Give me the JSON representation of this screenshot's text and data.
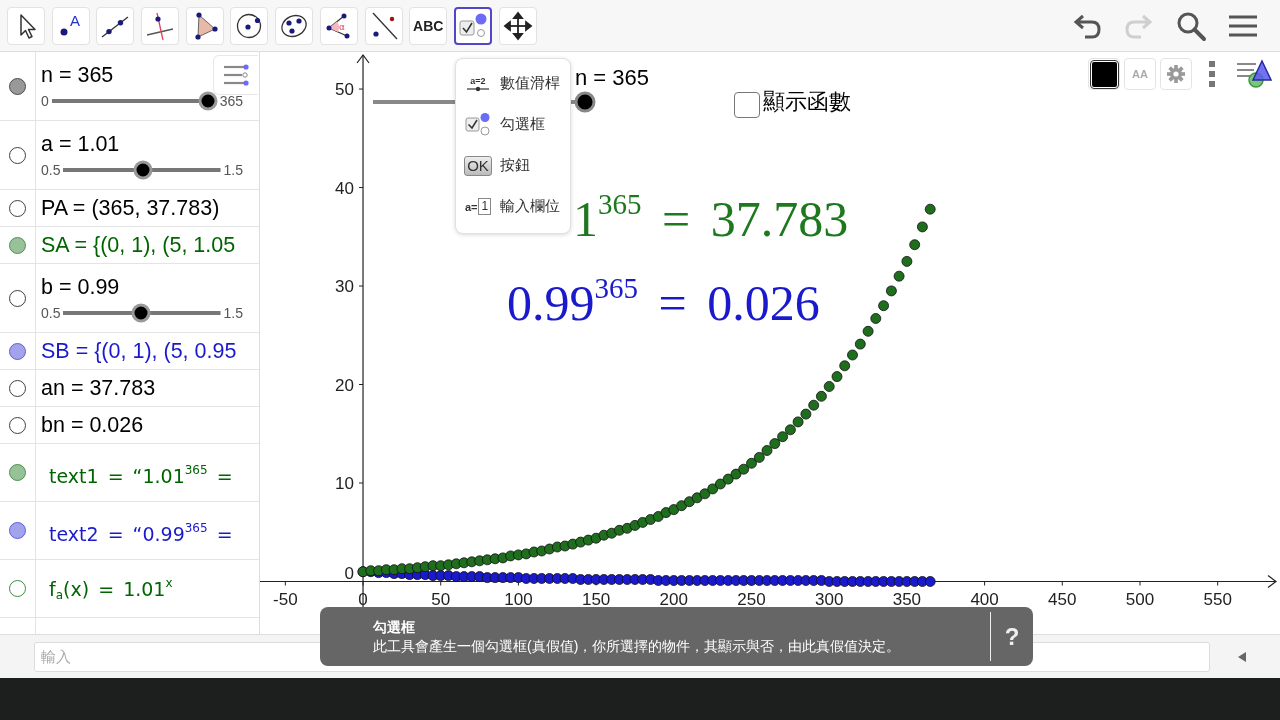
{
  "toolbar": {
    "tools": [
      {
        "kind": "move",
        "selected": false
      },
      {
        "kind": "point",
        "icon_text": "A",
        "selected": false
      },
      {
        "kind": "line",
        "selected": false
      },
      {
        "kind": "perpendicular",
        "selected": false
      },
      {
        "kind": "polygon",
        "selected": false
      },
      {
        "kind": "circle",
        "selected": false
      },
      {
        "kind": "conic",
        "selected": false
      },
      {
        "kind": "angle",
        "icon_text": "α",
        "selected": false
      },
      {
        "kind": "reflect",
        "selected": false
      },
      {
        "kind": "text",
        "label": "ABC",
        "selected": false
      },
      {
        "kind": "checkbox",
        "selected": true
      },
      {
        "kind": "move_view",
        "selected": false
      }
    ],
    "actions": [
      {
        "kind": "undo",
        "disabled": false
      },
      {
        "kind": "redo",
        "disabled": true
      },
      {
        "kind": "search"
      },
      {
        "kind": "menu"
      }
    ]
  },
  "tool_menu": {
    "items": [
      {
        "kind": "slider",
        "icon_text": "a=2",
        "label": "數值滑桿"
      },
      {
        "kind": "checkbox",
        "label": "勾選框"
      },
      {
        "kind": "button",
        "icon_text": "OK",
        "label": "按鈕"
      },
      {
        "kind": "input",
        "icon_text": "a=",
        "box_text": "1",
        "label": "輸入欄位"
      }
    ]
  },
  "algebra": {
    "rows": [
      {
        "kind": "slider",
        "text": "n = 365",
        "color": "#000000",
        "visible": true,
        "min": "0",
        "max": "365",
        "level": 1
      },
      {
        "kind": "slider",
        "text": "a = 1.01",
        "color": "#000000",
        "visible": false,
        "min": "0.5",
        "max": "1.5",
        "level": 0.51
      },
      {
        "kind": "value",
        "text": "PA = (365, 37.783)",
        "color": "#000000",
        "visible": false
      },
      {
        "kind": "value",
        "text": "SA = {(0, 1), (5, 1.05",
        "color": "#006400",
        "visible": true
      },
      {
        "kind": "slider",
        "text": "b = 0.99",
        "color": "#000000",
        "visible": false,
        "min": "0.5",
        "max": "1.5",
        "level": 0.49
      },
      {
        "kind": "value",
        "text": "SB = {(0, 1), (5, 0.95",
        "color": "#1a1acc",
        "visible": true
      },
      {
        "kind": "value",
        "text": "an = 37.783",
        "color": "#000000",
        "visible": false
      },
      {
        "kind": "value",
        "text": "bn = 0.026",
        "color": "#000000",
        "visible": false
      },
      {
        "kind": "formula",
        "text": "text1 = “1.01$^{365}$ =",
        "color": "#006400",
        "visible": true
      },
      {
        "kind": "formula",
        "text": "text2 = “0.99$^{365}$ =",
        "color": "#1a1acc",
        "visible": true
      },
      {
        "kind": "formula",
        "text": "f$_{a}$(x) = 1.01$^{x}$",
        "color": "#006400",
        "visible": false
      }
    ]
  },
  "graphics": {
    "style_bar": [
      {
        "kind": "color",
        "color": "#000000"
      },
      {
        "kind": "text_size",
        "label": "AA"
      },
      {
        "kind": "settings"
      },
      {
        "kind": "more"
      },
      {
        "kind": "view"
      }
    ],
    "slider": {
      "label": "n = 365",
      "level": 1
    },
    "checkbox": {
      "label": "顯示函數",
      "checked": false
    },
    "texts": [
      {
        "text": "1$^{365}$ = 37.783",
        "color": "#1e781e"
      },
      {
        "text": "0.99$^{365}$ = 0.026",
        "color": "#1a1acc"
      }
    ],
    "chart_data": {
      "type": "scatter",
      "xlim": [
        -66.3,
        590.1
      ],
      "ylim": [
        -5.33,
        53.76
      ],
      "xticks": [
        -50,
        0,
        50,
        100,
        150,
        200,
        250,
        300,
        350,
        400,
        450,
        500,
        550
      ],
      "yticks": [
        0,
        10,
        20,
        30,
        40,
        50
      ],
      "x": [
        0,
        5,
        10,
        15,
        20,
        25,
        30,
        35,
        40,
        45,
        50,
        55,
        60,
        65,
        70,
        75,
        80,
        85,
        90,
        95,
        100,
        105,
        110,
        115,
        120,
        125,
        130,
        135,
        140,
        145,
        150,
        155,
        160,
        165,
        170,
        175,
        180,
        185,
        190,
        195,
        200,
        205,
        210,
        215,
        220,
        225,
        230,
        235,
        240,
        245,
        250,
        255,
        260,
        265,
        270,
        275,
        280,
        285,
        290,
        295,
        300,
        305,
        310,
        315,
        320,
        325,
        330,
        335,
        340,
        345,
        350,
        355,
        360,
        365
      ],
      "series": [
        {
          "color": "#1e6e1e",
          "values": [
            1,
            1.1,
            1.1,
            1.2,
            1.2,
            1.3,
            1.3,
            1.4,
            1.5,
            1.6,
            1.6,
            1.7,
            1.8,
            1.9,
            2,
            2.1,
            2.2,
            2.3,
            2.4,
            2.6,
            2.7,
            2.8,
            3,
            3.1,
            3.3,
            3.5,
            3.6,
            3.8,
            4,
            4.2,
            4.4,
            4.7,
            4.9,
            5.2,
            5.4,
            5.7,
            6,
            6.3,
            6.6,
            7,
            7.3,
            7.7,
            8.1,
            8.5,
            8.9,
            9.4,
            9.9,
            10.4,
            10.9,
            11.4,
            12,
            12.6,
            13.3,
            14,
            14.7,
            15.4,
            16.2,
            17,
            17.9,
            18.8,
            19.8,
            20.8,
            21.9,
            23,
            24.1,
            25.4,
            26.7,
            28,
            29.5,
            31,
            32.5,
            34.2,
            36,
            37.8
          ]
        },
        {
          "color": "#1a1acc",
          "values": [
            1,
            1,
            0.9,
            0.9,
            0.8,
            0.8,
            0.7,
            0.7,
            0.7,
            0.6,
            0.6,
            0.6,
            0.5,
            0.5,
            0.5,
            0.5,
            0.4,
            0.4,
            0.4,
            0.4,
            0.4,
            0.3,
            0.3,
            0.3,
            0.3,
            0.3,
            0.3,
            0.3,
            0.2,
            0.2,
            0.2,
            0.2,
            0.2,
            0.2,
            0.2,
            0.2,
            0.2,
            0.2,
            0.1,
            0.1,
            0.1,
            0.1,
            0.1,
            0.1,
            0.1,
            0.1,
            0.1,
            0.1,
            0.1,
            0.1,
            0.1,
            0.1,
            0.1,
            0.1,
            0.1,
            0.1,
            0.1,
            0.1,
            0.1,
            0.1,
            0,
            0,
            0,
            0,
            0,
            0,
            0,
            0,
            0,
            0,
            0,
            0,
            0,
            0
          ]
        }
      ]
    }
  },
  "input_bar": {
    "placeholder": "輸入"
  },
  "tooltip": {
    "title": "勾選框",
    "text": "此工具會產生一個勾選框(真假值)，你所選擇的物件，其顯示與否，由此真假值決定。",
    "help": "?"
  }
}
